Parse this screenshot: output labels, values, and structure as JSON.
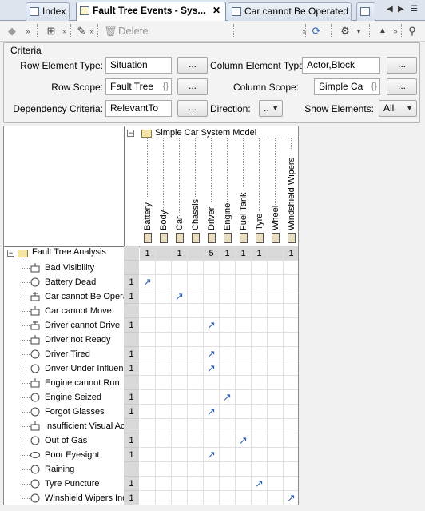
{
  "tabs": [
    {
      "label": "Index",
      "active": false
    },
    {
      "label": "Fault Tree  Events - Sys...",
      "active": true,
      "close": "✕"
    },
    {
      "label": "Car cannot Be Operated",
      "active": false
    },
    {
      "label": "",
      "active": false
    }
  ],
  "toolbar": {
    "delete_label": "Delete"
  },
  "criteria": {
    "title": "Criteria",
    "row_element_type_label": "Row Element Type:",
    "row_element_type_value": "Situation",
    "row_scope_label": "Row Scope:",
    "row_scope_value": "Fault Tree",
    "dependency_criteria_label": "Dependency Criteria:",
    "dependency_criteria_value": "RelevantTo",
    "column_element_type_label": "Column Element Type:",
    "column_element_type_value": "Actor,Block",
    "column_scope_label": "Column Scope:",
    "column_scope_value": "Simple Ca",
    "direction_label": "Direction:",
    "direction_value": "..",
    "show_elements_label": "Show Elements:",
    "show_elements_value": "All",
    "browse_label": "...",
    "expr_glyph": "{}"
  },
  "matrix": {
    "column_root": "Simple Car System Model",
    "columns": [
      "Battery",
      "Body",
      "Car",
      "Chassis",
      "Driver",
      "Engine",
      "Fuel Tank",
      "Tyre",
      "Wheel",
      "Windshield Wipers"
    ],
    "column_counts": [
      "1",
      "",
      "1",
      "",
      "5",
      "1",
      "1",
      "1",
      "",
      "1"
    ],
    "row_root": "Fault Tree Analysis",
    "rows": [
      {
        "label": "Bad Visibility",
        "icon": "gate-icon",
        "count": "",
        "col": -1
      },
      {
        "label": "Battery Dead",
        "icon": "circle-icon",
        "count": "1",
        "col": 0
      },
      {
        "label": "Car cannot Be Opera",
        "icon": "tree-gate-icon",
        "count": "1",
        "col": 2
      },
      {
        "label": "Car cannot Move",
        "icon": "gate-icon",
        "count": "",
        "col": -1
      },
      {
        "label": "Driver cannot Drive",
        "icon": "tree-gate-icon",
        "count": "1",
        "col": 4
      },
      {
        "label": "Driver not Ready",
        "icon": "gate-icon",
        "count": "",
        "col": -1
      },
      {
        "label": "Driver Tired",
        "icon": "circle-icon",
        "count": "1",
        "col": 4
      },
      {
        "label": "Driver Under Influen",
        "icon": "circle-icon",
        "count": "1",
        "col": 4
      },
      {
        "label": "Engine cannot Run",
        "icon": "gate-icon",
        "count": "",
        "col": -1
      },
      {
        "label": "Engine Seized",
        "icon": "circle-icon",
        "count": "1",
        "col": 5
      },
      {
        "label": "Forgot Glasses",
        "icon": "circle-icon",
        "count": "1",
        "col": 4
      },
      {
        "label": "Insufficient Visual Ac",
        "icon": "gate-icon",
        "count": "",
        "col": -1
      },
      {
        "label": "Out of Gas",
        "icon": "circle-icon",
        "count": "1",
        "col": 6
      },
      {
        "label": "Poor Eyesight",
        "icon": "ellipse-icon",
        "count": "1",
        "col": 4
      },
      {
        "label": "Raining",
        "icon": "circle-icon",
        "count": "",
        "col": -1
      },
      {
        "label": "Tyre Puncture",
        "icon": "circle-icon",
        "count": "1",
        "col": 7
      },
      {
        "label": "Winshield Wipers Ind",
        "icon": "circle-icon",
        "count": "1",
        "col": 9
      }
    ],
    "arrow_glyph": "↗"
  }
}
